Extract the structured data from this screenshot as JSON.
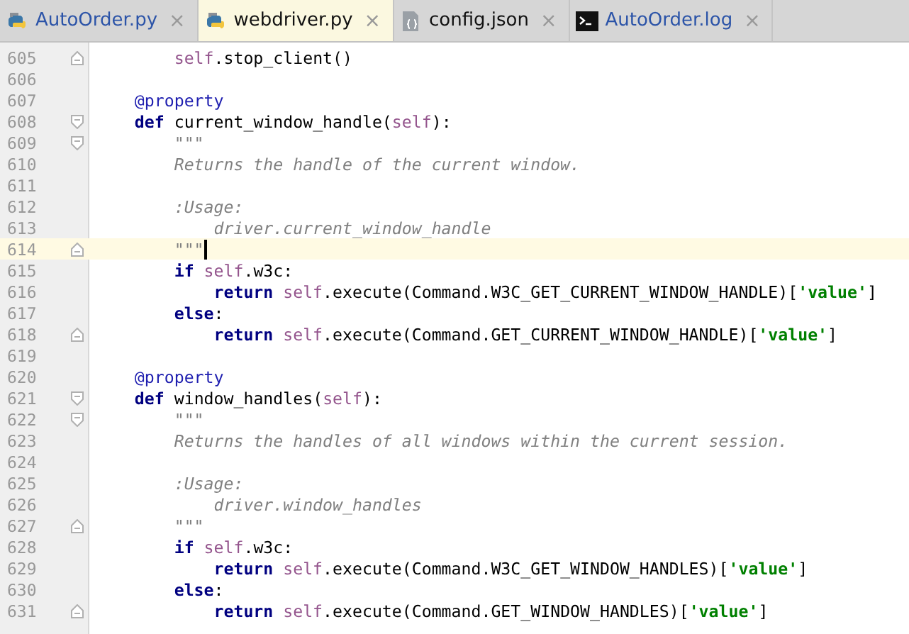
{
  "tabs": [
    {
      "label": "AutoOrder.py",
      "kind": "python",
      "selected": false,
      "modified": true,
      "close": "×"
    },
    {
      "label": "webdriver.py",
      "kind": "python",
      "selected": true,
      "modified": false,
      "close": "×"
    },
    {
      "label": "config.json",
      "kind": "json",
      "selected": false,
      "modified": false,
      "close": "×"
    },
    {
      "label": "AutoOrder.log",
      "kind": "log",
      "selected": false,
      "modified": true,
      "close": "×"
    }
  ],
  "lines": [
    {
      "number": "605",
      "fold": {
        "kind": "end"
      },
      "current": false,
      "tokens": [
        {
          "t": "        self",
          "kind": "self"
        },
        {
          "t": ".stop_client()",
          "kind": "plain"
        }
      ]
    },
    {
      "number": "606",
      "current": false
    },
    {
      "number": "607",
      "current": false,
      "tokens": [
        {
          "t": "    @property",
          "kind": "deco"
        }
      ]
    },
    {
      "number": "608",
      "fold": {
        "kind": "start"
      },
      "current": false,
      "tokens": [
        {
          "t": "    def",
          "kind": "kw"
        },
        {
          "t": " current_window_handle(",
          "kind": "plain"
        },
        {
          "t": "self",
          "kind": "self"
        },
        {
          "t": "):",
          "kind": "plain"
        }
      ]
    },
    {
      "number": "609",
      "fold": {
        "kind": "start"
      },
      "current": false,
      "tokens": [
        {
          "t": "        \"\"\"",
          "kind": "doc"
        }
      ]
    },
    {
      "number": "610",
      "current": false,
      "tokens": [
        {
          "t": "        Returns the handle of the current window.",
          "kind": "doc"
        }
      ]
    },
    {
      "number": "611",
      "current": false
    },
    {
      "number": "612",
      "current": false,
      "tokens": [
        {
          "t": "        :Usage:",
          "kind": "doc"
        }
      ]
    },
    {
      "number": "613",
      "current": false,
      "tokens": [
        {
          "t": "            driver.current_window_handle",
          "kind": "doc"
        }
      ]
    },
    {
      "number": "614",
      "fold": {
        "kind": "end"
      },
      "current": true,
      "tokens": [
        {
          "t": "        \"\"\"",
          "kind": "doc"
        }
      ]
    },
    {
      "number": "615",
      "current": false,
      "tokens": [
        {
          "t": "        if",
          "kind": "kw"
        },
        {
          "t": " self",
          "kind": "self"
        },
        {
          "t": ".w3c:",
          "kind": "plain"
        }
      ]
    },
    {
      "number": "616",
      "current": false,
      "tokens": [
        {
          "t": "            return",
          "kind": "kw"
        },
        {
          "t": " self",
          "kind": "self"
        },
        {
          "t": ".execute(Command.W3C_GET_CURRENT_WINDOW_HANDLE)[",
          "kind": "plain"
        },
        {
          "t": "'value'",
          "kind": "str"
        },
        {
          "t": "]",
          "kind": "plain"
        }
      ]
    },
    {
      "number": "617",
      "current": false,
      "tokens": [
        {
          "t": "        else",
          "kind": "kw"
        },
        {
          "t": ":",
          "kind": "plain"
        }
      ]
    },
    {
      "number": "618",
      "fold": {
        "kind": "end"
      },
      "current": false,
      "tokens": [
        {
          "t": "            return",
          "kind": "kw"
        },
        {
          "t": " self",
          "kind": "self"
        },
        {
          "t": ".execute(Command.GET_CURRENT_WINDOW_HANDLE)[",
          "kind": "plain"
        },
        {
          "t": "'value'",
          "kind": "str"
        },
        {
          "t": "]",
          "kind": "plain"
        }
      ]
    },
    {
      "number": "619",
      "current": false
    },
    {
      "number": "620",
      "current": false,
      "tokens": [
        {
          "t": "    @property",
          "kind": "deco"
        }
      ]
    },
    {
      "number": "621",
      "fold": {
        "kind": "start"
      },
      "current": false,
      "tokens": [
        {
          "t": "    def",
          "kind": "kw"
        },
        {
          "t": " window_handles(",
          "kind": "plain"
        },
        {
          "t": "self",
          "kind": "self"
        },
        {
          "t": "):",
          "kind": "plain"
        }
      ]
    },
    {
      "number": "622",
      "fold": {
        "kind": "start"
      },
      "current": false,
      "tokens": [
        {
          "t": "        \"\"\"",
          "kind": "doc"
        }
      ]
    },
    {
      "number": "623",
      "current": false,
      "tokens": [
        {
          "t": "        Returns the handles of all windows within the current session.",
          "kind": "doc"
        }
      ]
    },
    {
      "number": "624",
      "current": false
    },
    {
      "number": "625",
      "current": false,
      "tokens": [
        {
          "t": "        :Usage:",
          "kind": "doc"
        }
      ]
    },
    {
      "number": "626",
      "current": false,
      "tokens": [
        {
          "t": "            driver.window_handles",
          "kind": "doc"
        }
      ]
    },
    {
      "number": "627",
      "fold": {
        "kind": "end"
      },
      "current": false,
      "tokens": [
        {
          "t": "        \"\"\"",
          "kind": "doc"
        }
      ]
    },
    {
      "number": "628",
      "current": false,
      "tokens": [
        {
          "t": "        if",
          "kind": "kw"
        },
        {
          "t": " self",
          "kind": "self"
        },
        {
          "t": ".w3c:",
          "kind": "plain"
        }
      ]
    },
    {
      "number": "629",
      "current": false,
      "tokens": [
        {
          "t": "            return",
          "kind": "kw"
        },
        {
          "t": " self",
          "kind": "self"
        },
        {
          "t": ".execute(Command.W3C_GET_WINDOW_HANDLES)[",
          "kind": "plain"
        },
        {
          "t": "'value'",
          "kind": "str"
        },
        {
          "t": "]",
          "kind": "plain"
        }
      ]
    },
    {
      "number": "630",
      "current": false,
      "tokens": [
        {
          "t": "        else",
          "kind": "kw"
        },
        {
          "t": ":",
          "kind": "plain"
        }
      ]
    },
    {
      "number": "631",
      "fold": {
        "kind": "end"
      },
      "current": false,
      "tokens": [
        {
          "t": "            return",
          "kind": "kw"
        },
        {
          "t": " self",
          "kind": "self"
        },
        {
          "t": ".execute(Command.GET_WINDOW_HANDLES)[",
          "kind": "plain"
        },
        {
          "t": "'value'",
          "kind": "str"
        },
        {
          "t": "]",
          "kind": "plain"
        }
      ]
    }
  ]
}
